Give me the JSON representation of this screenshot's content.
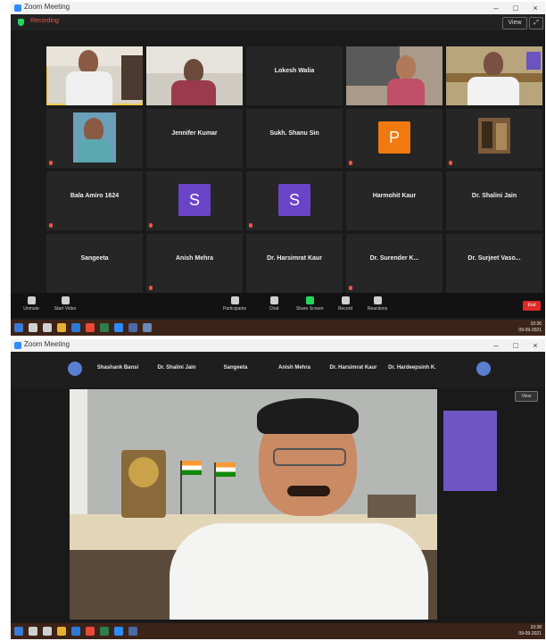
{
  "top_window": {
    "title": "Zoom Meeting",
    "recording": "Recording",
    "view_label": "View",
    "tiles": [
      {
        "kind": "video",
        "name": "",
        "active": true
      },
      {
        "kind": "video",
        "name": ""
      },
      {
        "kind": "text",
        "name": "Lokesh Walia"
      },
      {
        "kind": "video",
        "name": ""
      },
      {
        "kind": "video",
        "name": ""
      },
      {
        "kind": "video",
        "name": ""
      },
      {
        "kind": "text",
        "name": "Jennifer Kumar"
      },
      {
        "kind": "text",
        "name": "Sukh. Shanu Sin"
      },
      {
        "kind": "avatar",
        "letter": "P",
        "color": "#f07a10",
        "caption": ""
      },
      {
        "kind": "photo",
        "name": ""
      },
      {
        "kind": "text",
        "name": "Bala Amiro 1624"
      },
      {
        "kind": "avatar",
        "letter": "S",
        "color": "#6a44c7",
        "caption": ""
      },
      {
        "kind": "avatar",
        "letter": "S",
        "color": "#6a44c7",
        "caption": ""
      },
      {
        "kind": "text",
        "name": "Harmohit Kaur"
      },
      {
        "kind": "text",
        "name": "Dr. Shalini Jain"
      },
      {
        "kind": "text",
        "name": "Sangeeta"
      },
      {
        "kind": "text",
        "name": "Anish Mehra"
      },
      {
        "kind": "text",
        "name": "Dr. Harsimrat Kaur"
      },
      {
        "kind": "text",
        "name": "Dr. Surender K..."
      },
      {
        "kind": "text",
        "name": "Dr. Surjeet Vaso..."
      }
    ],
    "controls": [
      {
        "label": "Unmute"
      },
      {
        "label": "Start Video"
      },
      {
        "label": "Participants"
      },
      {
        "label": "Chat"
      },
      {
        "label": "Share Screen",
        "green": true
      },
      {
        "label": "Record"
      },
      {
        "label": "Reactions"
      }
    ],
    "end_label": "End",
    "tray_time": "10:36",
    "tray_date": "09-09-2021"
  },
  "bottom_window": {
    "title": "Zoom Meeting",
    "strip": [
      "Shashank Bansi",
      "Dr. Shalini Jain",
      "Sangeeta",
      "Anish Mehra",
      "Dr. Harsimrat Kaur",
      "Dr. Hardeepsinh K."
    ],
    "speaker_view_label": "View",
    "tray_time": "10:38",
    "tray_date": "09-09-2021"
  },
  "colors": {
    "zoom_blue": "#2d8cff",
    "end_red": "#e02828",
    "active_yellow": "#f2c94c"
  }
}
